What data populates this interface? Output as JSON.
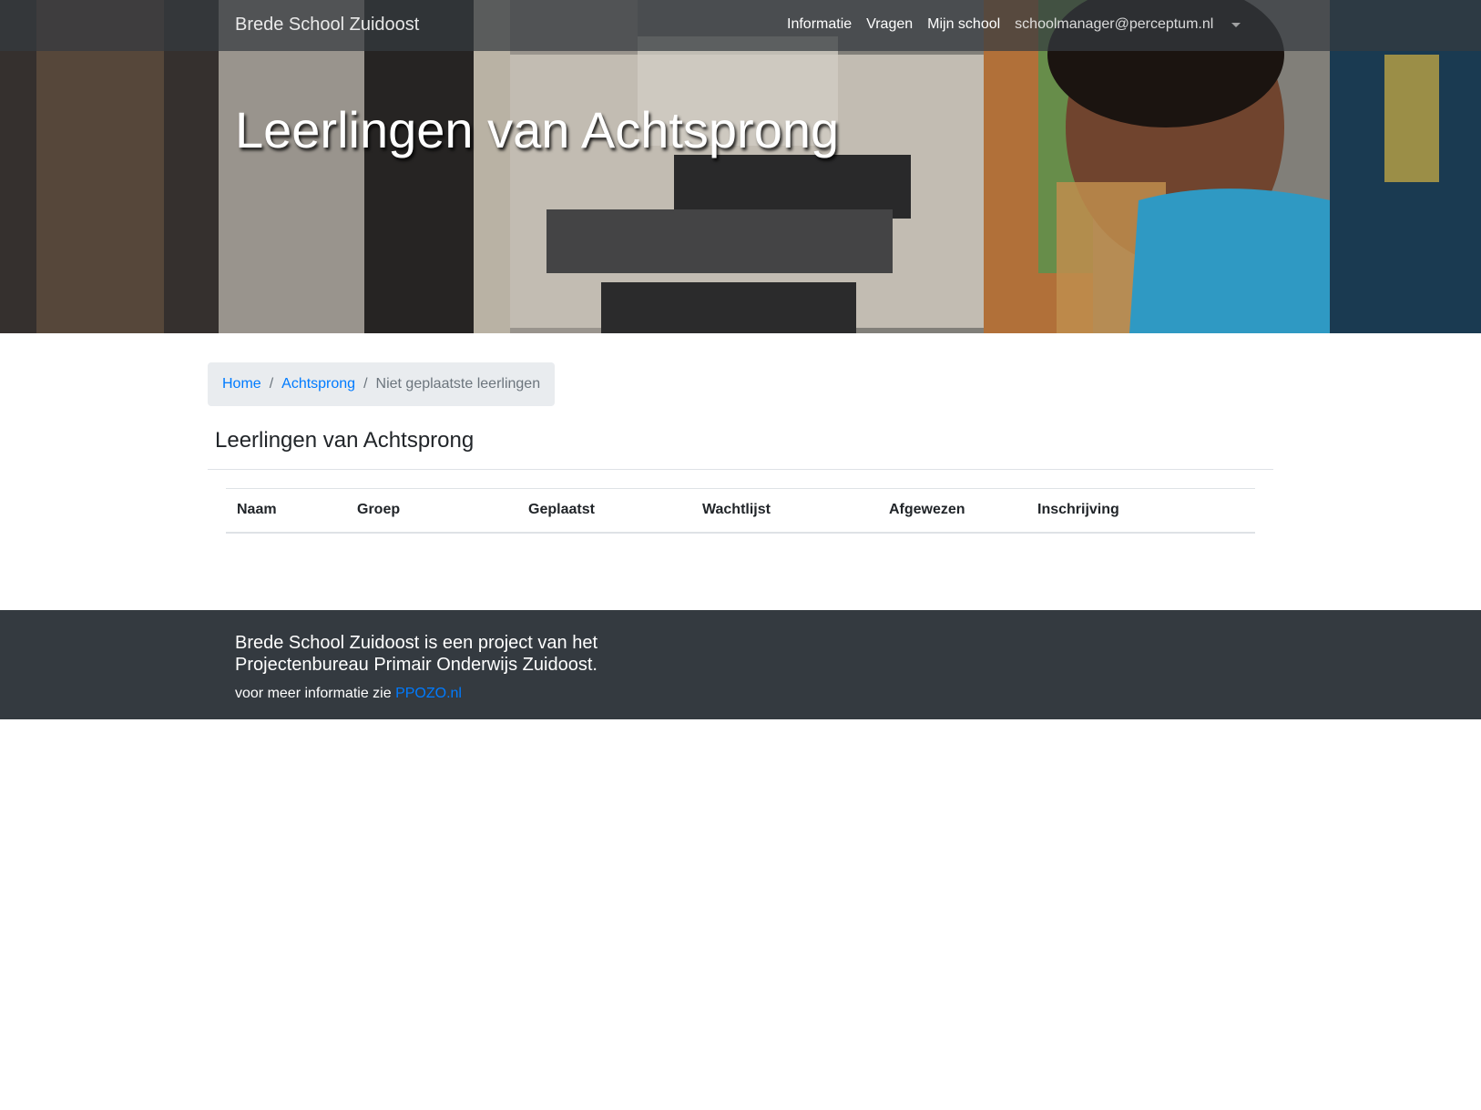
{
  "navbar": {
    "brand": "Brede School Zuidoost",
    "links": [
      "Informatie",
      "Vragen",
      "Mijn school"
    ],
    "user_email": "schoolmanager@perceptum.nl"
  },
  "hero": {
    "title": "Leerlingen van Achtsprong"
  },
  "breadcrumb": {
    "home": "Home",
    "school": "Achtsprong",
    "current": "Niet geplaatste leerlingen",
    "separator": "/"
  },
  "main": {
    "title": "Leerlingen van Achtsprong",
    "table": {
      "headers": [
        "Naam",
        "Groep",
        "Geplaatst",
        "Wachtlijst",
        "Afgewezen",
        "Inschrijving"
      ]
    }
  },
  "footer": {
    "lead": "Brede School Zuidoost is een project van het Projectenbureau Primair Onderwijs Zuidoost.",
    "info_prefix": "voor meer informatie zie",
    "info_link": "PPOZO.nl"
  },
  "colors": {
    "link": "#007bff",
    "footer_bg": "#343a40",
    "breadcrumb_bg": "#e9ecef"
  }
}
